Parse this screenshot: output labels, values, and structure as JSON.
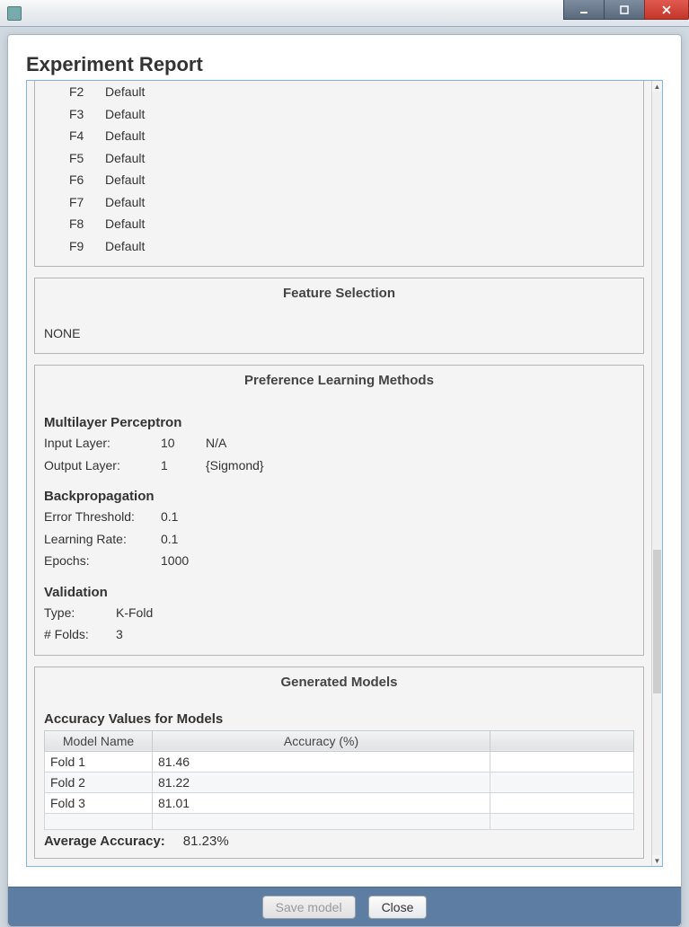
{
  "window": {
    "title": ""
  },
  "page": {
    "title": "Experiment Report"
  },
  "features": [
    {
      "id": "F2",
      "value": "Default"
    },
    {
      "id": "F3",
      "value": "Default"
    },
    {
      "id": "F4",
      "value": "Default"
    },
    {
      "id": "F5",
      "value": "Default"
    },
    {
      "id": "F6",
      "value": "Default"
    },
    {
      "id": "F7",
      "value": "Default"
    },
    {
      "id": "F8",
      "value": "Default"
    },
    {
      "id": "F9",
      "value": "Default"
    }
  ],
  "featureSelection": {
    "title": "Feature Selection",
    "value": "NONE"
  },
  "plm": {
    "title": "Preference Learning Methods",
    "mlp": {
      "title": "Multilayer Perceptron",
      "inputLayerLabel": "Input Layer:",
      "inputLayerCount": "10",
      "inputLayerAct": "N/A",
      "outputLayerLabel": "Output Layer:",
      "outputLayerCount": "1",
      "outputLayerAct": "{Sigmond}"
    },
    "bp": {
      "title": "Backpropagation",
      "errorThresholdLabel": "Error Threshold:",
      "errorThreshold": "0.1",
      "learningRateLabel": "Learning Rate:",
      "learningRate": "0.1",
      "epochsLabel": "Epochs:",
      "epochs": "1000"
    },
    "validation": {
      "title": "Validation",
      "typeLabel": "Type:",
      "type": "K-Fold",
      "foldsLabel": "# Folds:",
      "folds": "3"
    }
  },
  "models": {
    "title": "Generated Models",
    "subtitle": "Accuracy Values for Models",
    "headers": {
      "model": "Model Name",
      "accuracy": "Accuracy (%)"
    },
    "rows": [
      {
        "name": "Fold 1",
        "accuracy": "81.46"
      },
      {
        "name": "Fold 2",
        "accuracy": "81.22"
      },
      {
        "name": "Fold 3",
        "accuracy": "81.01"
      }
    ],
    "avgLabel": "Average Accuracy:",
    "avgValue": "81.23%"
  },
  "buttons": {
    "save": "Save model",
    "close": "Close"
  },
  "chart_data": {
    "type": "table",
    "title": "Accuracy Values for Models",
    "columns": [
      "Model Name",
      "Accuracy (%)"
    ],
    "rows": [
      [
        "Fold 1",
        81.46
      ],
      [
        "Fold 2",
        81.22
      ],
      [
        "Fold 3",
        81.01
      ]
    ],
    "summary": {
      "Average Accuracy": 81.23
    }
  }
}
